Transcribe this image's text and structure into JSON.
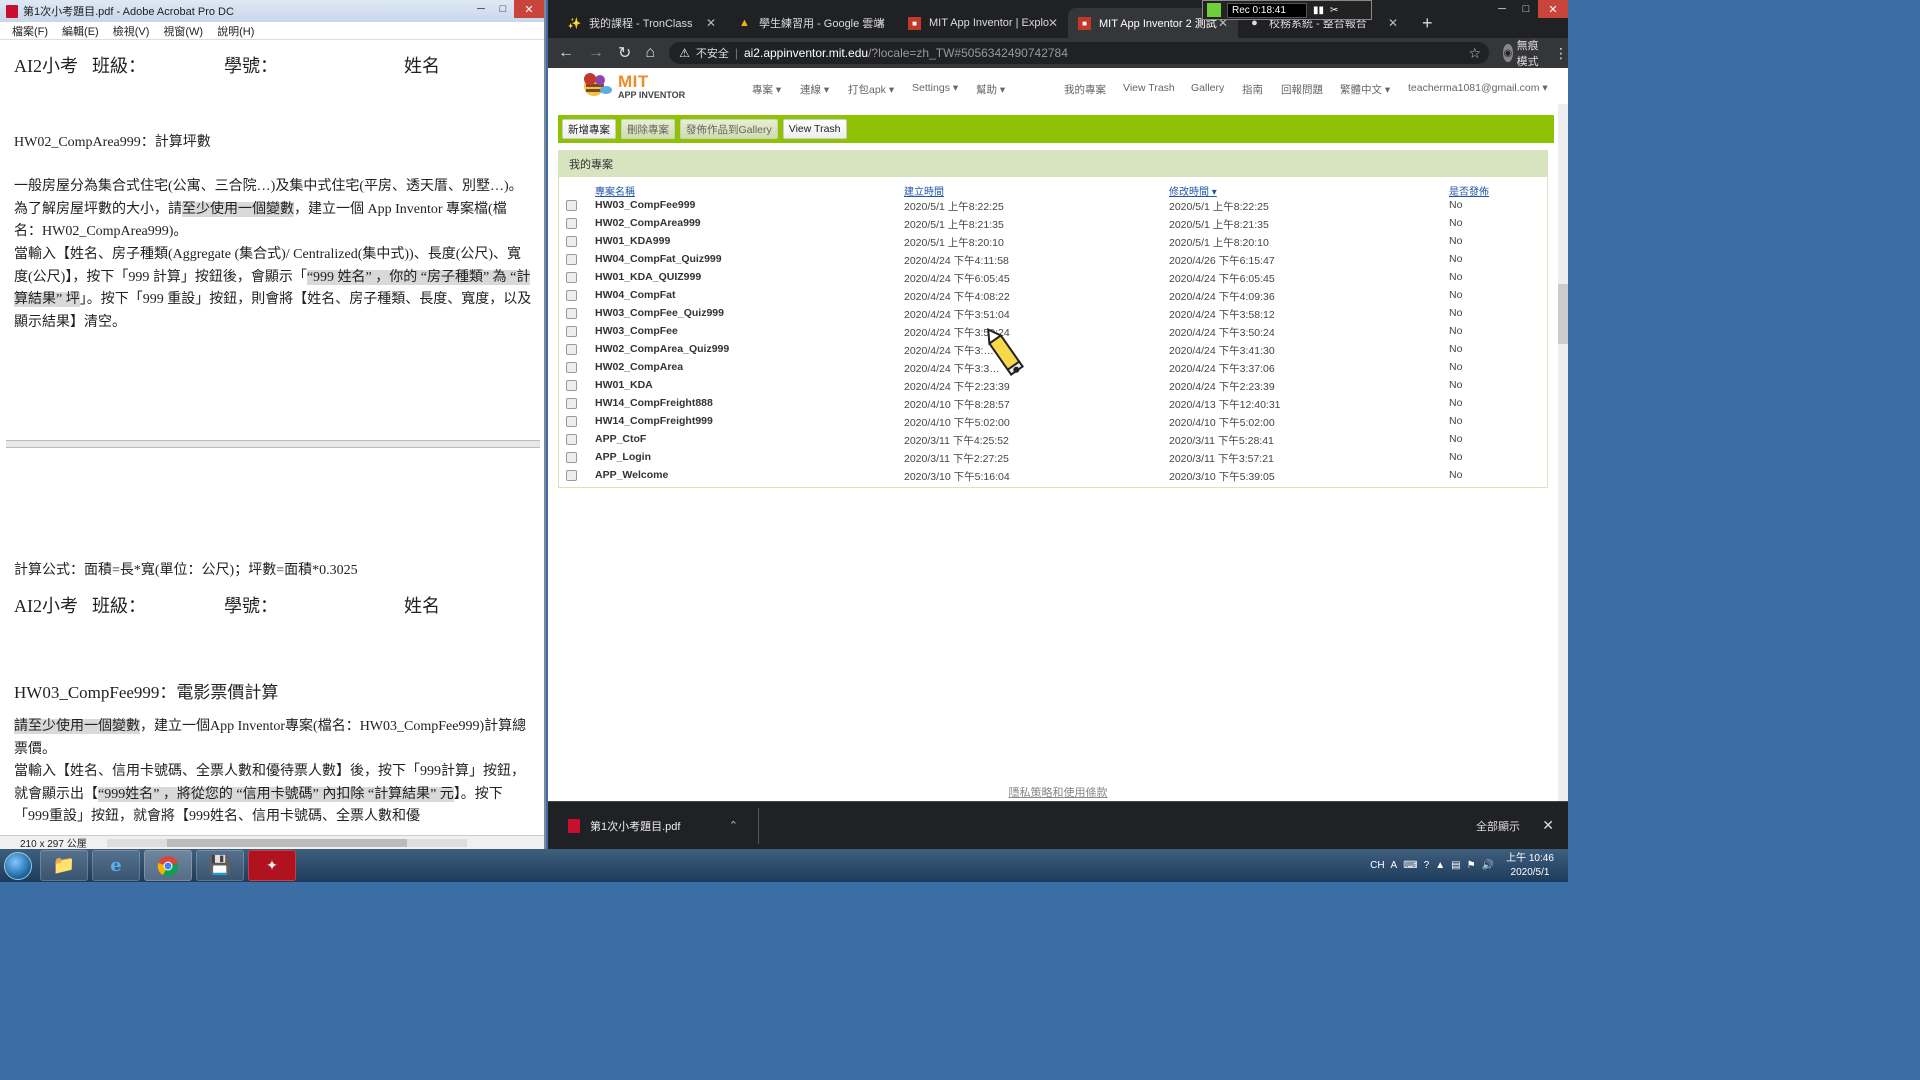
{
  "acrobat": {
    "title": "第1次小考題目.pdf - Adobe Acrobat Pro DC",
    "menu": [
      "檔案(F)",
      "編輯(E)",
      "檢視(V)",
      "視窗(W)",
      "說明(H)"
    ],
    "page1": {
      "header": {
        "exam": "AI2小考",
        "class_label": "班級：",
        "id_label": "學號：",
        "name_label": "姓名"
      },
      "title": "HW02_CompArea999：計算坪數",
      "para1_a": "一般房屋分為集合式住宅(公寓、三合院…)及集中式住宅(平房、透天厝、別墅…)。為了解房屋坪數的大小，請",
      "para1_hl": "至少使用一個變數",
      "para1_b": "，建立一個 App Inventor 專案檔(檔名：HW02_CompArea999)。",
      "para2_a": "當輸入【姓名、房子種類(Aggregate (集合式)/ Centralized(集中式))、長度(公尺)、寬度(公尺)】，按下「999 計算」按鈕後，會顯示「",
      "para2_hl": "“999 姓名” ，你的 “房子種類” 為 “計算結果” 坪",
      "para2_b": "」。按下「999 重設」按鈕，則會將【姓名、房子種類、長度、寬度，以及顯示結果】清空。"
    },
    "page2": {
      "formula": "計算公式：面積=長*寬(單位：公尺)；坪數=面積*0.3025",
      "header": {
        "exam": "AI2小考",
        "class_label": "班級：",
        "id_label": "學號：",
        "name_label": "姓名"
      },
      "title": "HW03_CompFee999：電影票價計算",
      "para1_hl": "請至少使用一個變數",
      "para1_b": "，建立一個App Inventor專案(檔名：HW03_CompFee999)計算總票價。",
      "para2_a": "當輸入【姓名、信用卡號碼、全票人數和優待票人數】後，按下「999計算」按鈕，就會顯示出【",
      "para2_hl": "“999姓名” ，將從您的 “信用卡號碼” 內扣除 “計算結果” 元",
      "para2_b": "】。按下「999重設」按鈕，就會將【999姓名、信用卡號碼、全票人數和優"
    },
    "status_size": "210 x 297 公厘"
  },
  "chrome": {
    "tabs": [
      {
        "label": "我的課程 - TronClass",
        "icon": "tronclass-icon"
      },
      {
        "label": "學生練習用 - Google 雲端",
        "icon": "google-drive-icon"
      },
      {
        "label": "MIT App Inventor | Explo",
        "icon": "app-inventor-icon"
      },
      {
        "label": "MIT App Inventor 2 測試",
        "icon": "app-inventor-icon",
        "active": true
      },
      {
        "label": "校務系統 - 整合報合",
        "icon": "globe-icon"
      }
    ],
    "recorder_time": "Rec 0:18:41",
    "url_security": "不安全",
    "url_host": "ai2.appinventor.mit.edu",
    "url_path": "/?locale=zh_TW#5056342490742784",
    "incognito_label": "無痕模式",
    "download_file": "第1次小考題目.pdf",
    "show_all": "全部顯示"
  },
  "appinventor": {
    "brand_mit": "MIT",
    "brand_sub": "APP INVENTOR",
    "nav": [
      "專案 ▾",
      "連線 ▾",
      "打包apk ▾",
      "Settings ▾",
      "幫助 ▾"
    ],
    "nav_right": [
      "我的專案",
      "View Trash",
      "Gallery",
      "指南",
      "回報問題",
      "繁體中文 ▾",
      "teacherma1081@gmail.com ▾"
    ],
    "buttons": [
      "新增專案",
      "刪除專案",
      "發佈作品到Gallery",
      "View Trash"
    ],
    "panel_title": "我的專案",
    "columns": [
      "專案名稱",
      "建立時間",
      "修改時間 ▾",
      "是否發佈"
    ],
    "projects": [
      {
        "name": "HW03_CompFee999",
        "created": "2020/5/1 上午8:22:25",
        "modified": "2020/5/1 上午8:22:25",
        "published": "No"
      },
      {
        "name": "HW02_CompArea999",
        "created": "2020/5/1 上午8:21:35",
        "modified": "2020/5/1 上午8:21:35",
        "published": "No"
      },
      {
        "name": "HW01_KDA999",
        "created": "2020/5/1 上午8:20:10",
        "modified": "2020/5/1 上午8:20:10",
        "published": "No"
      },
      {
        "name": "HW04_CompFat_Quiz999",
        "created": "2020/4/24 下午4:11:58",
        "modified": "2020/4/26 下午6:15:47",
        "published": "No"
      },
      {
        "name": "HW01_KDA_QUIZ999",
        "created": "2020/4/24 下午6:05:45",
        "modified": "2020/4/24 下午6:05:45",
        "published": "No"
      },
      {
        "name": "HW04_CompFat",
        "created": "2020/4/24 下午4:08:22",
        "modified": "2020/4/24 下午4:09:36",
        "published": "No"
      },
      {
        "name": "HW03_CompFee_Quiz999",
        "created": "2020/4/24 下午3:51:04",
        "modified": "2020/4/24 下午3:58:12",
        "published": "No"
      },
      {
        "name": "HW03_CompFee",
        "created": "2020/4/24 下午3:50:24",
        "modified": "2020/4/24 下午3:50:24",
        "published": "No"
      },
      {
        "name": "HW02_CompArea_Quiz999",
        "created": "2020/4/24 下午3:…",
        "modified": "2020/4/24 下午3:41:30",
        "published": "No"
      },
      {
        "name": "HW02_CompArea",
        "created": "2020/4/24 下午3:3…",
        "modified": "2020/4/24 下午3:37:06",
        "published": "No"
      },
      {
        "name": "HW01_KDA",
        "created": "2020/4/24 下午2:23:39",
        "modified": "2020/4/24 下午2:23:39",
        "published": "No"
      },
      {
        "name": "HW14_CompFreight888",
        "created": "2020/4/10 下午8:28:57",
        "modified": "2020/4/13 下午12:40:31",
        "published": "No"
      },
      {
        "name": "HW14_CompFreight999",
        "created": "2020/4/10 下午5:02:00",
        "modified": "2020/4/10 下午5:02:00",
        "published": "No"
      },
      {
        "name": "APP_CtoF",
        "created": "2020/3/11 下午4:25:52",
        "modified": "2020/3/11 下午5:28:41",
        "published": "No"
      },
      {
        "name": "APP_Login",
        "created": "2020/3/11 下午2:27:25",
        "modified": "2020/3/11 下午3:57:21",
        "published": "No"
      },
      {
        "name": "APP_Welcome",
        "created": "2020/3/10 下午5:16:04",
        "modified": "2020/3/10 下午5:39:05",
        "published": "No"
      }
    ],
    "footer": "隱私策略和使用條款"
  },
  "taskbar": {
    "apps": [
      "windows-explorer-icon",
      "internet-explorer-icon",
      "chrome-icon",
      "file-icon",
      "acrobat-icon"
    ],
    "lang": "CH",
    "time": "上午 10:46",
    "date": "2020/5/1"
  }
}
